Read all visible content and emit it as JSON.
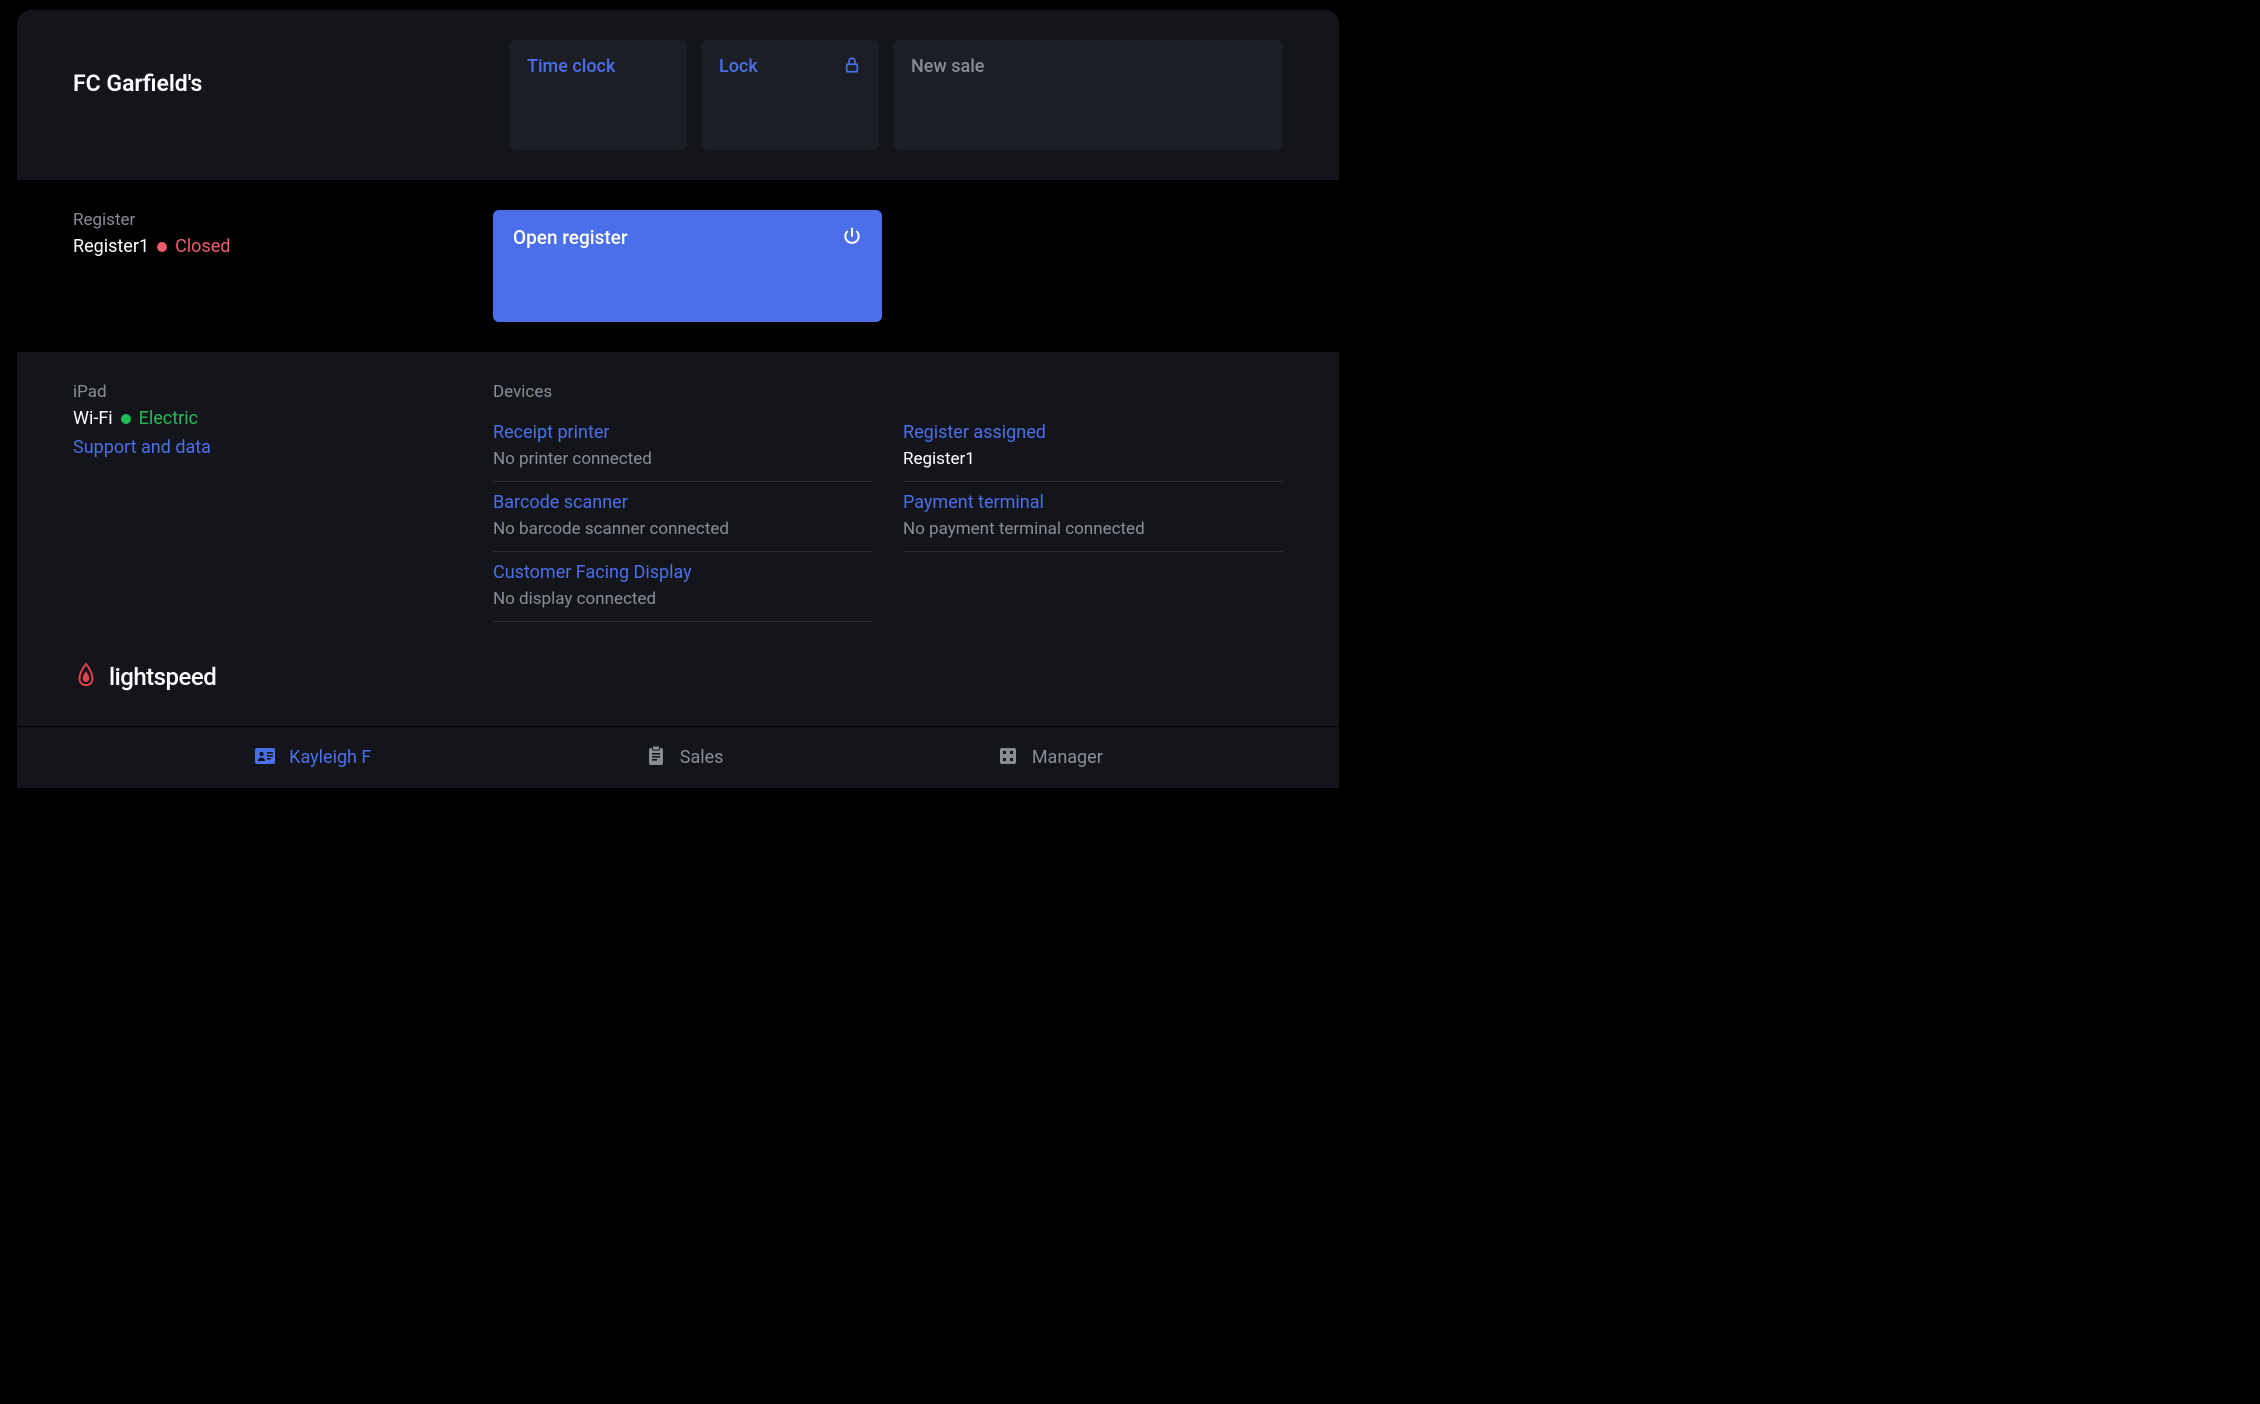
{
  "header": {
    "store_name": "FC Garfield's",
    "tiles": {
      "time_clock": "Time clock",
      "lock": "Lock",
      "new_sale": "New sale"
    }
  },
  "register": {
    "heading": "Register",
    "name": "Register1",
    "status": "Closed",
    "open_label": "Open register"
  },
  "ipad": {
    "heading": "iPad",
    "wifi_label": "Wi-Fi",
    "wifi_name": "Electric",
    "support_link": "Support and data"
  },
  "devices": {
    "heading": "Devices",
    "left": [
      {
        "title": "Receipt printer",
        "status": "No printer connected"
      },
      {
        "title": "Barcode scanner",
        "status": "No barcode scanner connected"
      },
      {
        "title": "Customer Facing Display",
        "status": "No display connected"
      }
    ],
    "right": [
      {
        "title": "Register assigned",
        "value": "Register1"
      },
      {
        "title": "Payment terminal",
        "status": "No payment terminal connected"
      }
    ]
  },
  "brand": {
    "name": "lightspeed"
  },
  "nav": {
    "user": "Kayleigh F",
    "sales": "Sales",
    "manager": "Manager"
  }
}
